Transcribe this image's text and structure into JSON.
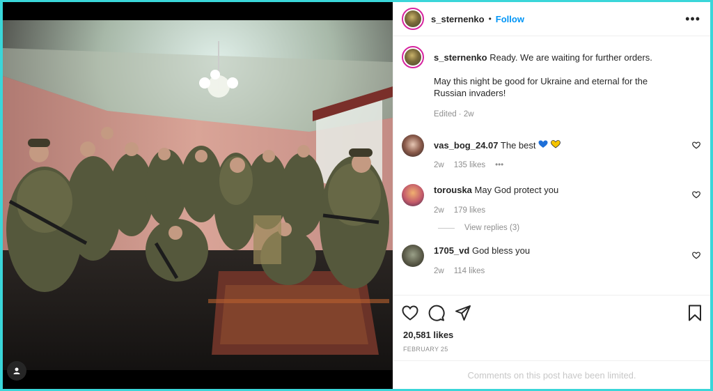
{
  "post": {
    "username": "s_sternenko",
    "follow_label": "Follow",
    "dot": "•",
    "more_label": "•••",
    "caption_line1": "Ready. We are waiting for further orders.",
    "caption_line2": "May this night be good for Ukraine and eternal for the Russian invaders!",
    "caption_meta": "Edited · 2w"
  },
  "comments": [
    {
      "user": "vas_bog_24.07",
      "text": "The best",
      "time": "2w",
      "likes": "135 likes",
      "more": "•••"
    },
    {
      "user": "torouska",
      "text": "May God protect you",
      "time": "2w",
      "likes": "179 likes",
      "view_replies": "View replies (3)"
    },
    {
      "user": "1705_vd",
      "text": "God bless you",
      "time": "2w",
      "likes": "114 likes"
    }
  ],
  "footer": {
    "likes": "20,581 likes",
    "date": "FEBRUARY 25",
    "limited": "Comments on this post have been limited."
  },
  "icons": [
    "heart-icon",
    "comment-icon",
    "share-icon",
    "bookmark-icon",
    "more-icon",
    "user-tag-icon"
  ],
  "colors": {
    "frame": "#3ad6d9",
    "follow": "#0095f6",
    "muted": "#8e8e8e"
  }
}
